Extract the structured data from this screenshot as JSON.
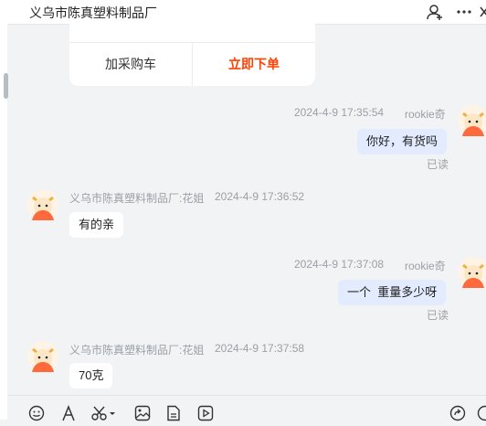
{
  "header": {
    "title": "义乌市陈真塑料制品厂"
  },
  "product_card": {
    "add_cart_label": "加采购车",
    "buy_now_label": "立即下单"
  },
  "messages": [
    {
      "side": "mine",
      "time": "2024-4-9 17:35:54",
      "sender": "rookie奇",
      "text": "你好，有货吗",
      "status": "已读"
    },
    {
      "side": "theirs",
      "sender": "义乌市陈真塑料制品厂:花姐",
      "time": "2024-4-9 17:36:52",
      "text": "有的亲"
    },
    {
      "side": "mine",
      "time": "2024-4-9 17:37:08",
      "sender": "rookie奇",
      "text": "一个  重量多少呀",
      "status": "已读"
    },
    {
      "side": "theirs",
      "sender": "义乌市陈真塑料制品厂:花姐",
      "time": "2024-4-9 17:37:58",
      "text": "70克"
    }
  ],
  "icons": {
    "header": [
      "add-contact-icon",
      "more-icon",
      "side-icon"
    ],
    "toolbar": [
      "emoji-icon",
      "font-icon",
      "scissors-icon",
      "image-icon",
      "file-icon",
      "video-icon",
      "share-icon",
      "extra-icon"
    ]
  },
  "colors": {
    "accent_buy": "#ff4000",
    "bubble_mine": "#e3ecff",
    "bubble_theirs": "#ffffff",
    "background": "#f2f3f5"
  }
}
